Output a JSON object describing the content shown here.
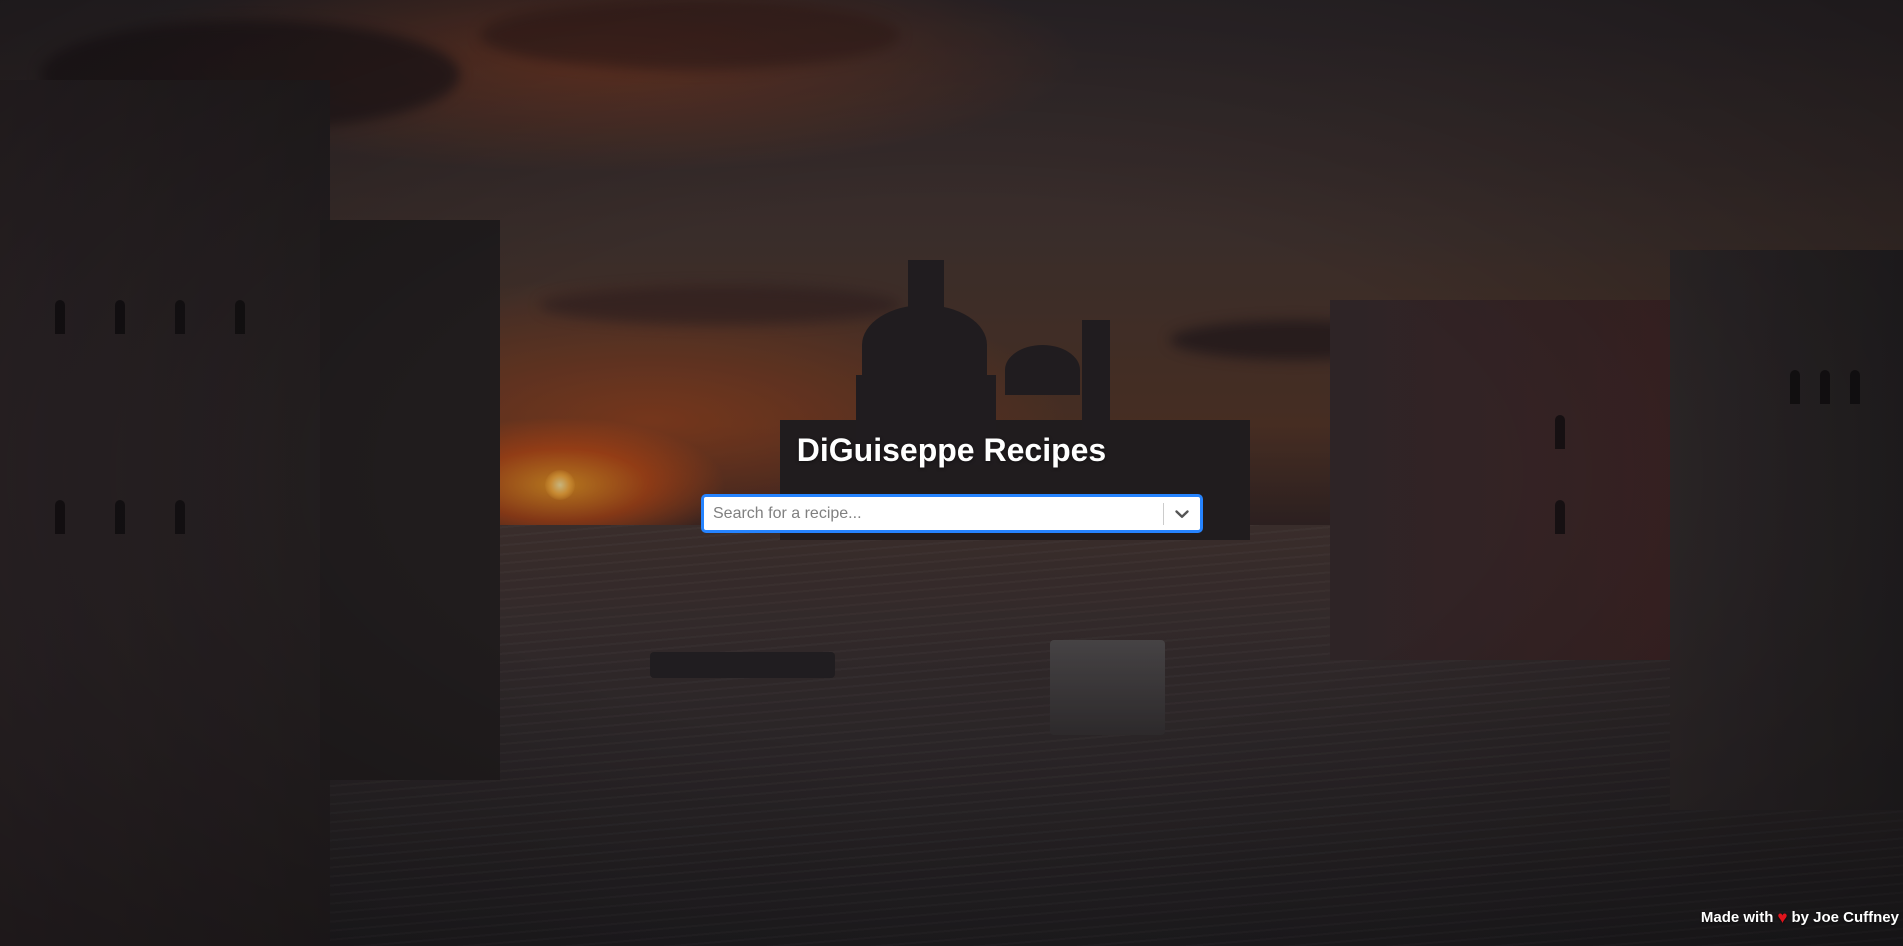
{
  "page": {
    "title": "DiGuiseppe Recipes"
  },
  "search": {
    "placeholder": "Search for a recipe...",
    "value": "",
    "dropdown_icon": "chevron-down-icon"
  },
  "footer": {
    "made_with": "Made with",
    "heart_icon": "heart-icon",
    "heart_glyph": "♥",
    "by": "by Joe Cuffney"
  },
  "colors": {
    "focus_border": "#2684ff",
    "heart": "#e0141c",
    "title_text": "#ffffff"
  }
}
